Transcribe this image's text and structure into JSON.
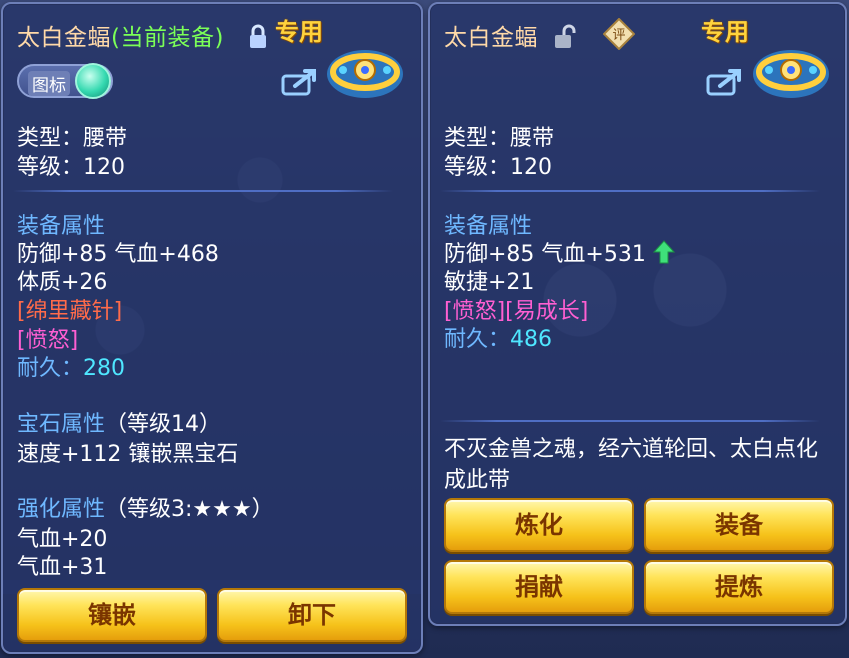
{
  "left_panel": {
    "item_name": "太白金蝠",
    "equipped_tag": "(当前装备)",
    "exclusive": "专用",
    "icon_toggle_label": "图标",
    "type_line": "类型：腰带",
    "level_line": "等级：120",
    "equip_attr_title": "装备属性",
    "attr_line1": "防御+85 气血+468",
    "attr_line2": "体质+26",
    "special1": "[绵里藏针]",
    "special2": "[愤怒]",
    "durability_label": "耐久：",
    "durability_value": "280",
    "gem_title": "宝石属性",
    "gem_level": "（等级14）",
    "gem_line": "速度+112 镶嵌黑宝石",
    "enhance_title": "强化属性",
    "enhance_level": "（等级3:★★★）",
    "enhance_line1": "气血+20",
    "enhance_line2": "气血+31",
    "buttons": {
      "inlay": "镶嵌",
      "unequip": "卸下"
    }
  },
  "right_panel": {
    "item_name": "太白金蝠",
    "eval_badge": "评",
    "exclusive": "专用",
    "type_line": "类型：腰带",
    "level_line": "等级：120",
    "equip_attr_title": "装备属性",
    "attr_line1": "防御+85 气血+531",
    "attr_line2": "敏捷+21",
    "special": "[愤怒][易成长]",
    "durability_label": "耐久：",
    "durability_value": "486",
    "description": "不灭金兽之魂，经六道轮回、太白点化成此带",
    "buttons": {
      "refine": "炼化",
      "equip": "装备",
      "donate": "捐献",
      "extract": "提炼"
    }
  },
  "colors": {
    "name": "#ffd9a8",
    "equipped": "#7bff57",
    "exclusive": "#ffd33d",
    "section_title": "#6fb8ff",
    "durability": "#4fe7ff",
    "special_red": "#ff6b4a",
    "special_pink": "#ff5fd2",
    "button_gold": "#ffe45a"
  },
  "icons": [
    "lock-icon",
    "unlock-icon",
    "share-icon",
    "belt-item-icon",
    "up-arrow-icon",
    "eval-badge-icon"
  ]
}
